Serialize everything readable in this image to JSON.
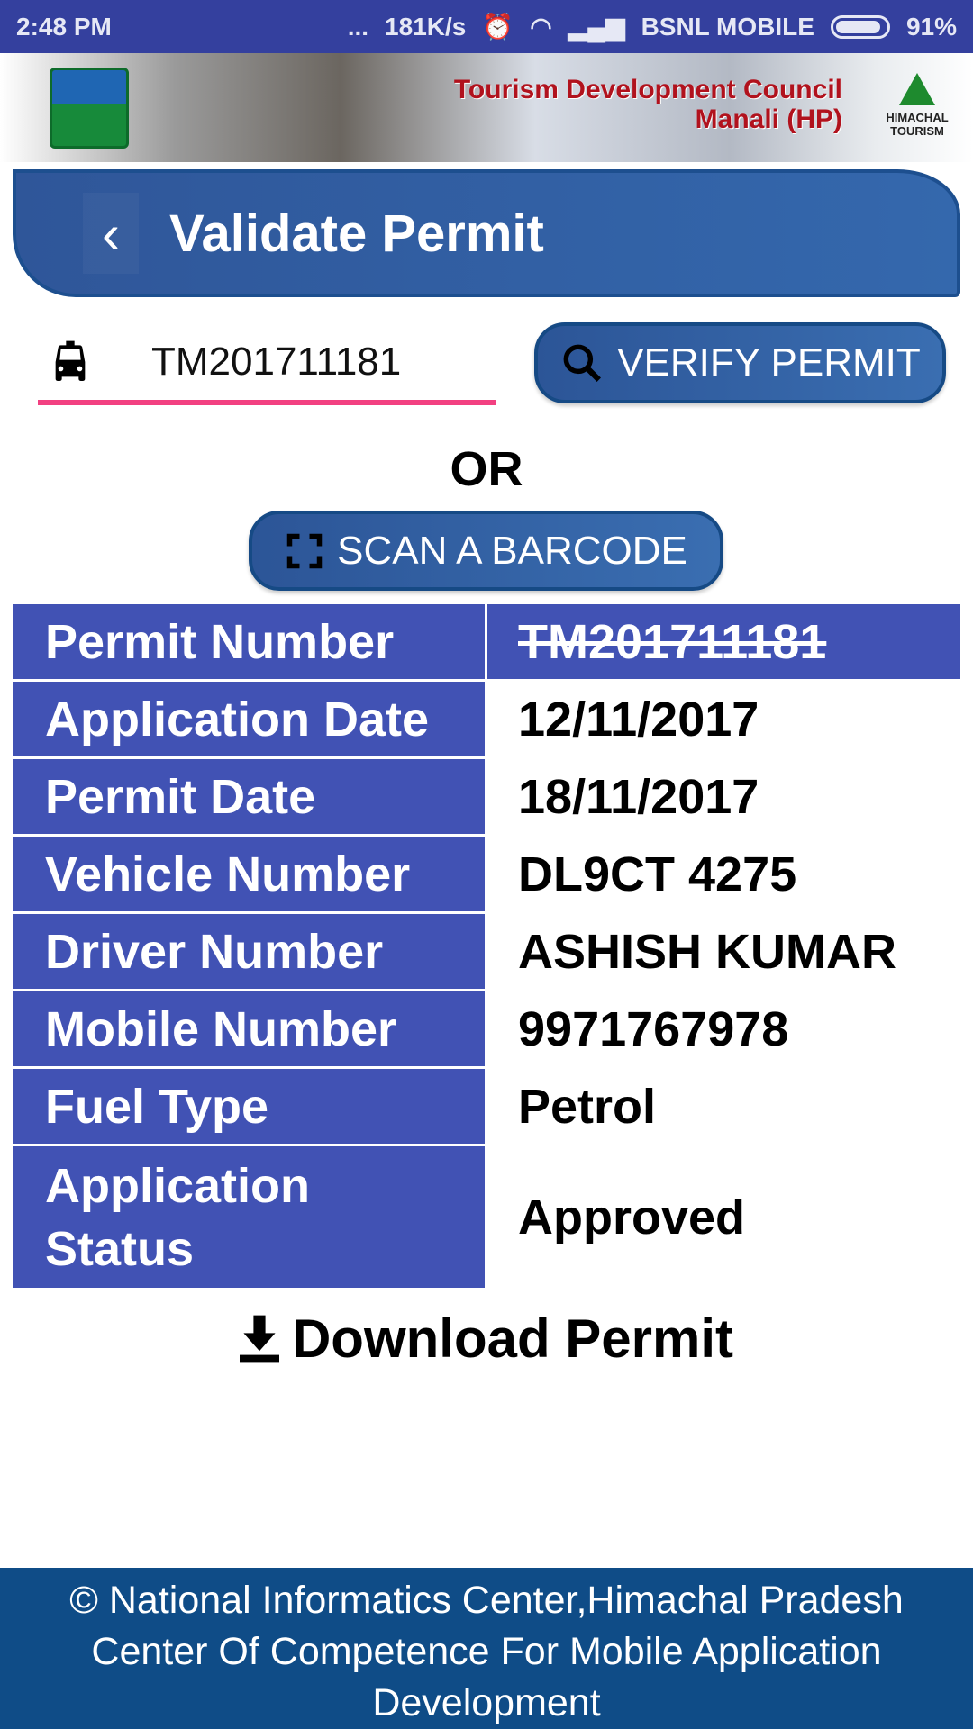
{
  "status_bar": {
    "time": "2:48 PM",
    "more": "...",
    "speed": "181K/s",
    "carrier": "BSNL MOBILE",
    "battery": "91%",
    "battery_level": 0.91
  },
  "banner": {
    "title_line1": "Tourism Development Council",
    "title_line2": "Manali (HP)",
    "partner_logo": "HIMACHAL TOURISM"
  },
  "header": {
    "title": "Validate Permit",
    "back_icon": "chevron-left-icon"
  },
  "search": {
    "value": "TM201711181",
    "icon": "taxi-icon",
    "underline_color": "#f24081"
  },
  "verify_button": {
    "label": "VERIFY PERMIT",
    "icon": "search-icon"
  },
  "or_label": "OR",
  "scan_button": {
    "label": "SCAN A BARCODE",
    "icon": "scan-frame-icon"
  },
  "details": [
    {
      "label": "Permit Number",
      "value": "TM201711181"
    },
    {
      "label": "Application Date",
      "value": "12/11/2017"
    },
    {
      "label": "Permit Date",
      "value": "18/11/2017"
    },
    {
      "label": "Vehicle Number",
      "value": "DL9CT 4275"
    },
    {
      "label": "Driver Number",
      "value": "ASHISH KUMAR"
    },
    {
      "label": "Mobile Number",
      "value": "9971767978"
    },
    {
      "label": "Fuel Type",
      "value": "Petrol"
    },
    {
      "label": "Application Status",
      "value": "Approved"
    }
  ],
  "download": {
    "label": "Download Permit",
    "icon": "download-icon"
  },
  "footer": {
    "line1": "© National Informatics Center,Himachal Pradesh",
    "line2": "Center Of Competence For Mobile Application Development"
  },
  "colors": {
    "status_bar": "#34409e",
    "table_label": "#4152b4",
    "button": "#2f5a9c",
    "footer": "#0f4c87"
  }
}
